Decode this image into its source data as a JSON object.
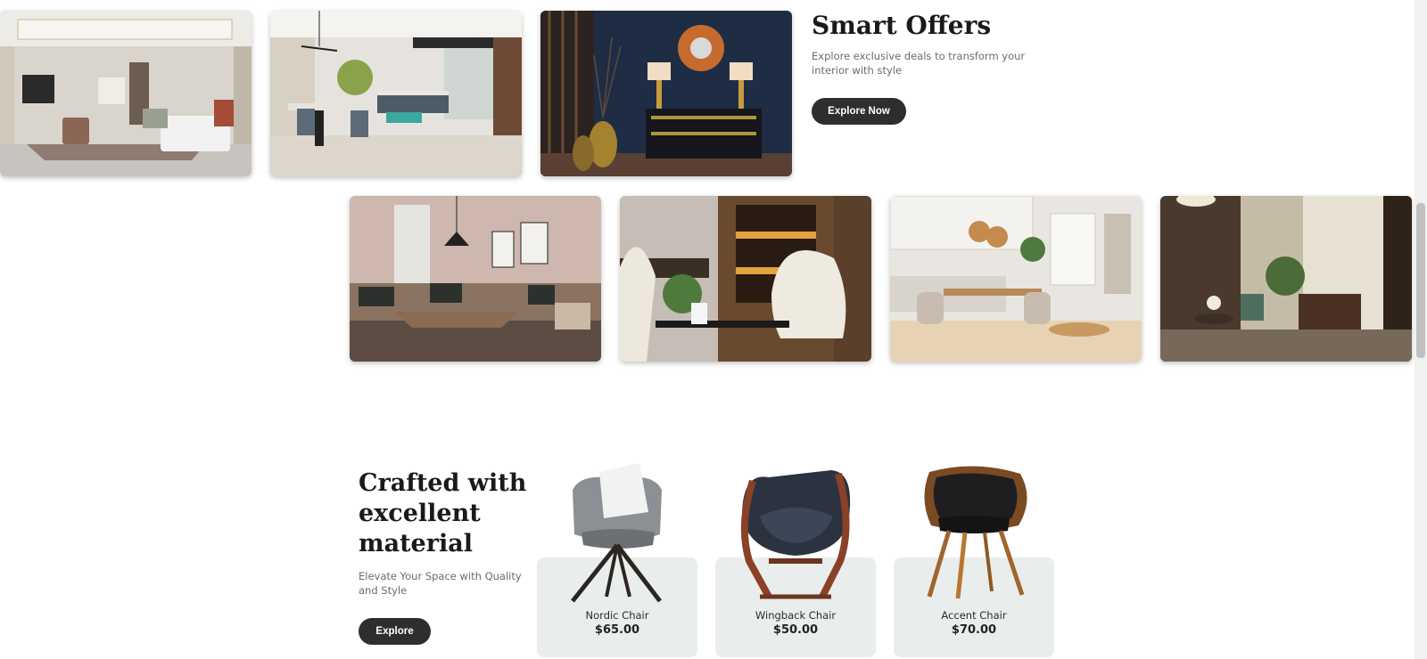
{
  "offers": {
    "title": "Smart Offers",
    "subtitle": "Explore exclusive deals to transform your interior with style",
    "button_label": "Explore Now"
  },
  "gallery": {
    "row1": [
      "living-room-photo",
      "open-living-dining-photo",
      "navy-console-photo"
    ],
    "row2": [
      "sofa-lounge-photo",
      "egg-chairs-photo",
      "kitchen-dining-photo",
      "wood-lounge-photo"
    ]
  },
  "crafted": {
    "title": "Crafted with excellent material",
    "subtitle": "Elevate Your Space with Quality and Style",
    "button_label": "Explore"
  },
  "products": [
    {
      "name": "Nordic Chair",
      "price": "$65.00"
    },
    {
      "name": "Wingback Chair",
      "price": "$50.00"
    },
    {
      "name": "Accent Chair",
      "price": "$70.00"
    }
  ],
  "colors": {
    "button_bg": "#2e2e2e",
    "card_bg": "#e9eeed",
    "text_dark": "#1a1a1a",
    "text_muted": "#6b6b6b"
  }
}
